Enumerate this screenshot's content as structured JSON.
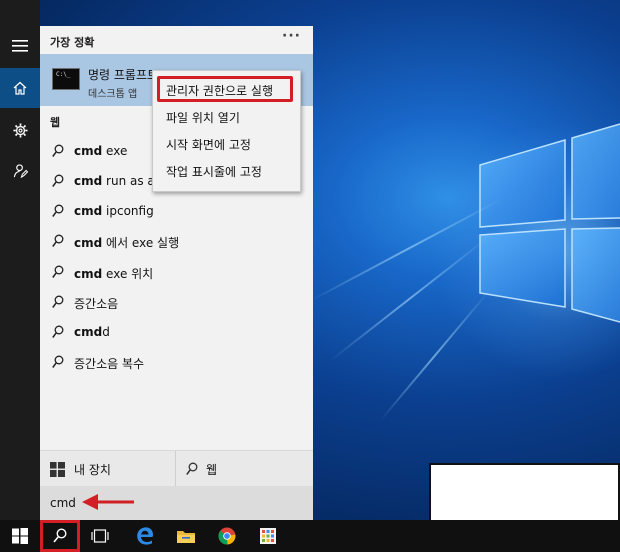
{
  "start_panel": {
    "section_best_match": "가장 정확",
    "more_label": "···",
    "best_match_app": {
      "name": "명령 프롬프트",
      "type": "데스크톱 앱",
      "icon": "cmd-prompt-icon"
    },
    "section_web": "웹",
    "suggestions": [
      {
        "bold": "cmd",
        "rest": " exe"
      },
      {
        "bold": "cmd",
        "rest": " run as administrator"
      },
      {
        "bold": "cmd",
        "rest": " ipconfig"
      },
      {
        "bold": "cmd",
        "rest": " 에서 exe 실행"
      },
      {
        "bold": "cmd",
        "rest": " exe 위치"
      },
      {
        "bold": "",
        "rest": "증간소음"
      },
      {
        "bold": "cmd",
        "rest": "d"
      },
      {
        "bold": "",
        "rest": "증간소음 복수"
      }
    ],
    "footer": {
      "my_device_label": "내 장치",
      "web_label": "웹"
    },
    "search_value": "cmd"
  },
  "context_menu": {
    "items": [
      "관리자 권한으로 실행",
      "파일 위치 열기",
      "시작 화면에 고정",
      "작업 표시줄에 고정"
    ]
  },
  "sidebar": {
    "icons": [
      "hamburger-menu-icon",
      "home-icon",
      "settings-gear-icon",
      "feedback-icon"
    ]
  },
  "taskbar": {
    "icons": [
      "windows-start-icon",
      "search-icon",
      "task-view-icon",
      "edge-icon",
      "file-explorer-icon",
      "chrome-icon",
      "store-icon"
    ]
  },
  "colors": {
    "annotation_red": "#d21f26",
    "selected_row": "#a9c6e3",
    "sidebar_dark": "#1c1c1c",
    "home_selected": "#0e4e86"
  }
}
